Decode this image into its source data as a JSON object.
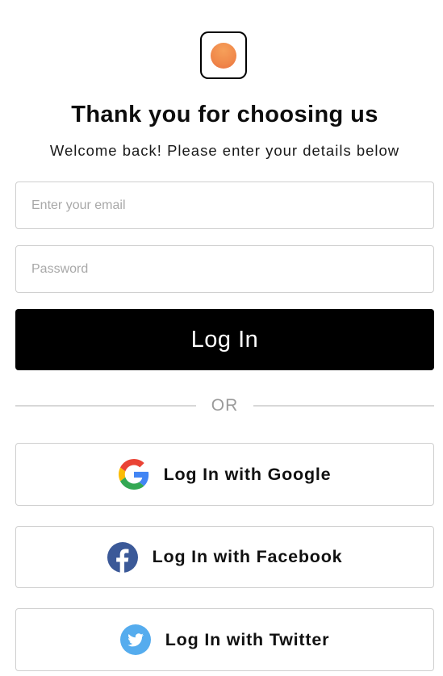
{
  "header": {
    "title": "Thank you for choosing us",
    "subtitle": "Welcome back! Please enter your details below"
  },
  "logo": {
    "icon": "orange-circle-logo",
    "accent_color": "#f08a4b"
  },
  "form": {
    "email_placeholder": "Enter your email",
    "email_value": "",
    "password_placeholder": "Password",
    "password_value": "",
    "login_label": "Log In"
  },
  "divider": {
    "label": "OR"
  },
  "social": {
    "google_label": "Log In with Google",
    "google_icon": "google-icon",
    "facebook_label": "Log In with Facebook",
    "facebook_icon": "facebook-icon",
    "facebook_color": "#3b5998",
    "twitter_label": "Log In with Twitter",
    "twitter_icon": "twitter-icon",
    "twitter_color": "#55acee"
  }
}
